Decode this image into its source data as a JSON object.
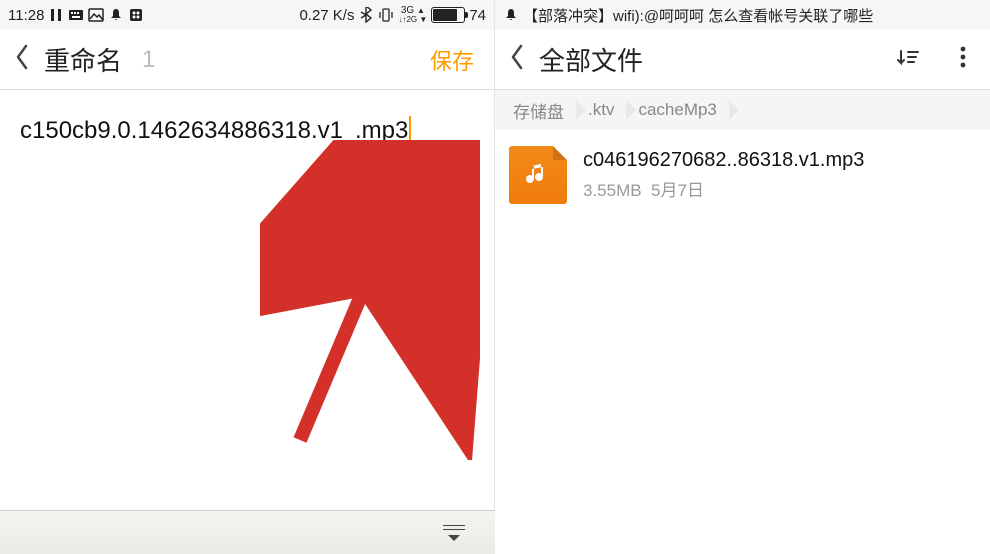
{
  "left": {
    "statusbar": {
      "time": "11:28",
      "speed": "0.27 K/s",
      "signal": "3G",
      "battery_pct": "74"
    },
    "header": {
      "title": "重命名",
      "count": "1",
      "save": "保存"
    },
    "rename": {
      "basename": "c150cb9.0.1462634886318.v1",
      "ext": ".mp3"
    },
    "keyboard": {
      "label": "keyboard-toggle"
    }
  },
  "right": {
    "statusbar": {
      "notification": "【部落冲突】wifi):@呵呵呵 怎么查看帐号关联了哪些"
    },
    "header": {
      "title": "全部文件"
    },
    "breadcrumb": [
      "存储盘",
      ".ktv",
      "cacheMp3"
    ],
    "file": {
      "name": "c046196270682..86318.v1.mp3",
      "size": "3.55MB",
      "date": "5月7日"
    }
  }
}
